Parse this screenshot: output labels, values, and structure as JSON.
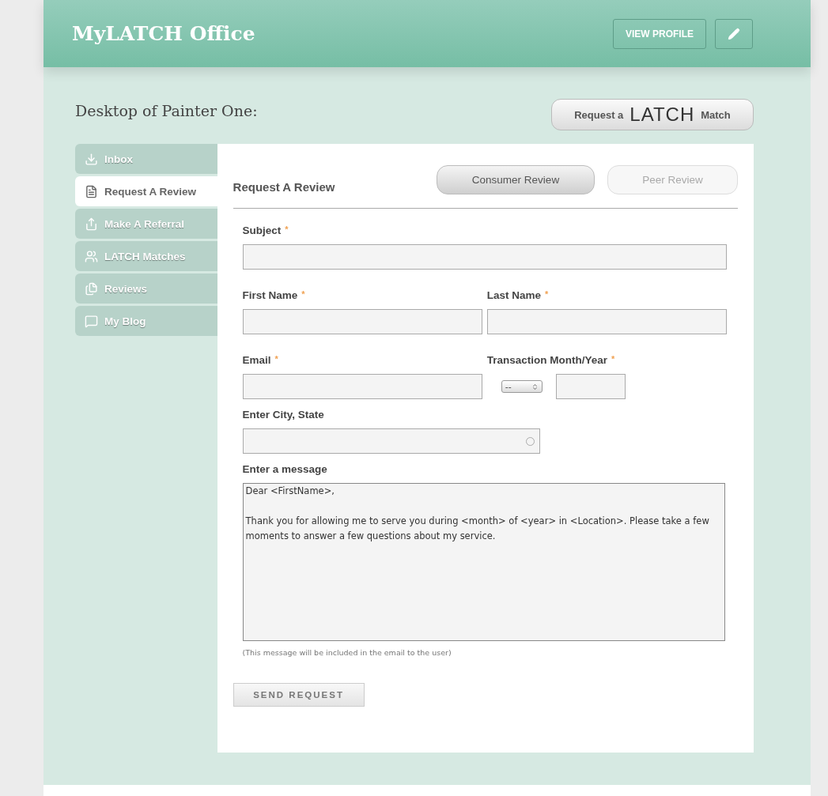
{
  "header": {
    "title": "MyLATCH Office",
    "view_profile": "VIEW PROFILE"
  },
  "desktop_title": "Desktop of Painter One:",
  "match_button": {
    "before": "Request a",
    "logo": "LATCH",
    "after": "Match"
  },
  "sidebar": {
    "items": [
      {
        "label": "Inbox",
        "selected": false
      },
      {
        "label": "Request A Review",
        "selected": true
      },
      {
        "label": "Make A Referral",
        "selected": false
      },
      {
        "label": "LATCH Matches",
        "selected": false
      },
      {
        "label": "Reviews",
        "selected": false
      },
      {
        "label": "My Blog",
        "selected": false
      }
    ]
  },
  "form": {
    "title": "Request A Review",
    "required_mark": "*",
    "review_types": [
      {
        "label": "Consumer Review",
        "selected": true
      },
      {
        "label": "Peer Review",
        "selected": false
      }
    ],
    "subject": {
      "label": "Subject",
      "required": true
    },
    "first_name": {
      "label": "First Name",
      "required": true
    },
    "last_name": {
      "label": "Last Name",
      "required": true
    },
    "email": {
      "label": "Email",
      "required": true
    },
    "transaction": {
      "label": "Transaction Month/Year",
      "required": true,
      "month": "--"
    },
    "city": {
      "label": "Enter City, State"
    },
    "message": {
      "label": "Enter a message",
      "value": "Dear <FirstName>,\n\nThank you for allowing me to serve you during <month> of <year> in <Location>. Please take a few moments to answer a few questions about my service."
    },
    "note": "(This message will be included in the email to the user)",
    "submit": "SEND REQUEST"
  }
}
